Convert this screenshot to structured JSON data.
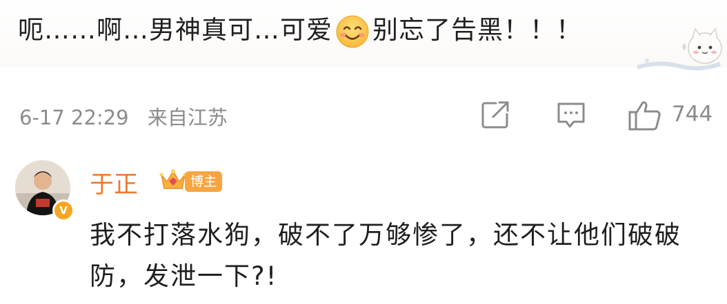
{
  "comment": {
    "text_before_emoji": "呃……啊…男神真可…可爱",
    "text_after_emoji": "别忘了告黑！！！",
    "emoji_icon": "smiling-face-emoji",
    "date": "6-17 22:29",
    "location": "来自江苏",
    "like_count": "744"
  },
  "reply": {
    "username": "于正",
    "badge": "博主",
    "text": "我不打落水狗，破不了万够惨了，还不让他们破破防，发泄一下?!"
  },
  "colors": {
    "username": "#e97b2e",
    "badge_bg": "#f7a541",
    "meta_gray": "#8b8b8b"
  }
}
